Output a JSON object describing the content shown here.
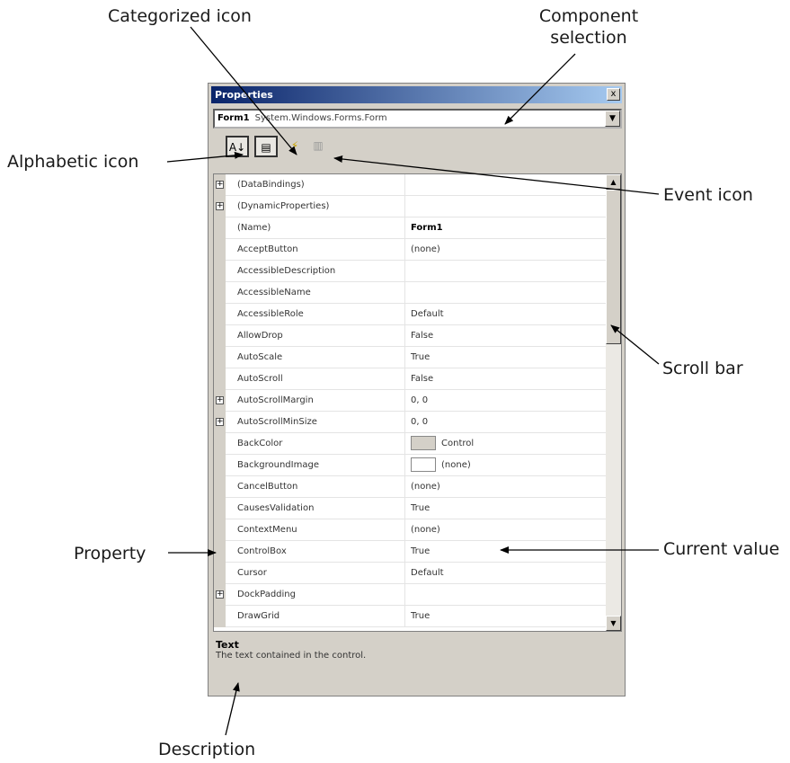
{
  "callouts": {
    "categorized_icon": "Categorized icon",
    "component_selection": "Component\nselection",
    "alphabetic_icon": "Alphabetic icon",
    "event_icon": "Event icon",
    "scroll_bar": "Scroll bar",
    "property": "Property",
    "current_value": "Current value",
    "description": "Description"
  },
  "window": {
    "title": "Properties",
    "close_glyph": "x",
    "component": {
      "name": "Form1",
      "type": "System.Windows.Forms.Form"
    },
    "toolbar": {
      "alphabetic_glyph": "A↓",
      "categorized_glyph": "▤",
      "events_glyph": "⚡",
      "pages_glyph": "▥"
    },
    "properties": [
      {
        "name": "(DataBindings)",
        "value": "",
        "expandable": true
      },
      {
        "name": "(DynamicProperties)",
        "value": "",
        "expandable": true
      },
      {
        "name": "(Name)",
        "value": "Form1",
        "bold": true
      },
      {
        "name": "AcceptButton",
        "value": "(none)"
      },
      {
        "name": "AccessibleDescription",
        "value": ""
      },
      {
        "name": "AccessibleName",
        "value": ""
      },
      {
        "name": "AccessibleRole",
        "value": "Default"
      },
      {
        "name": "AllowDrop",
        "value": "False"
      },
      {
        "name": "AutoScale",
        "value": "True"
      },
      {
        "name": "AutoScroll",
        "value": "False"
      },
      {
        "name": "AutoScrollMargin",
        "value": "0, 0",
        "expandable": true
      },
      {
        "name": "AutoScrollMinSize",
        "value": "0, 0",
        "expandable": true
      },
      {
        "name": "BackColor",
        "value": "Control",
        "swatch": "#d4d0c8"
      },
      {
        "name": "BackgroundImage",
        "value": "(none)",
        "swatch": "#ffffff"
      },
      {
        "name": "CancelButton",
        "value": "(none)"
      },
      {
        "name": "CausesValidation",
        "value": "True"
      },
      {
        "name": "ContextMenu",
        "value": "(none)"
      },
      {
        "name": "ControlBox",
        "value": "True"
      },
      {
        "name": "Cursor",
        "value": "Default"
      },
      {
        "name": "DockPadding",
        "value": "",
        "expandable": true
      },
      {
        "name": "DrawGrid",
        "value": "True"
      }
    ],
    "description": {
      "title": "Text",
      "text": "The text contained in the control."
    },
    "scroll_up_glyph": "▲",
    "scroll_down_glyph": "▼",
    "combo_arrow_glyph": "▼"
  }
}
